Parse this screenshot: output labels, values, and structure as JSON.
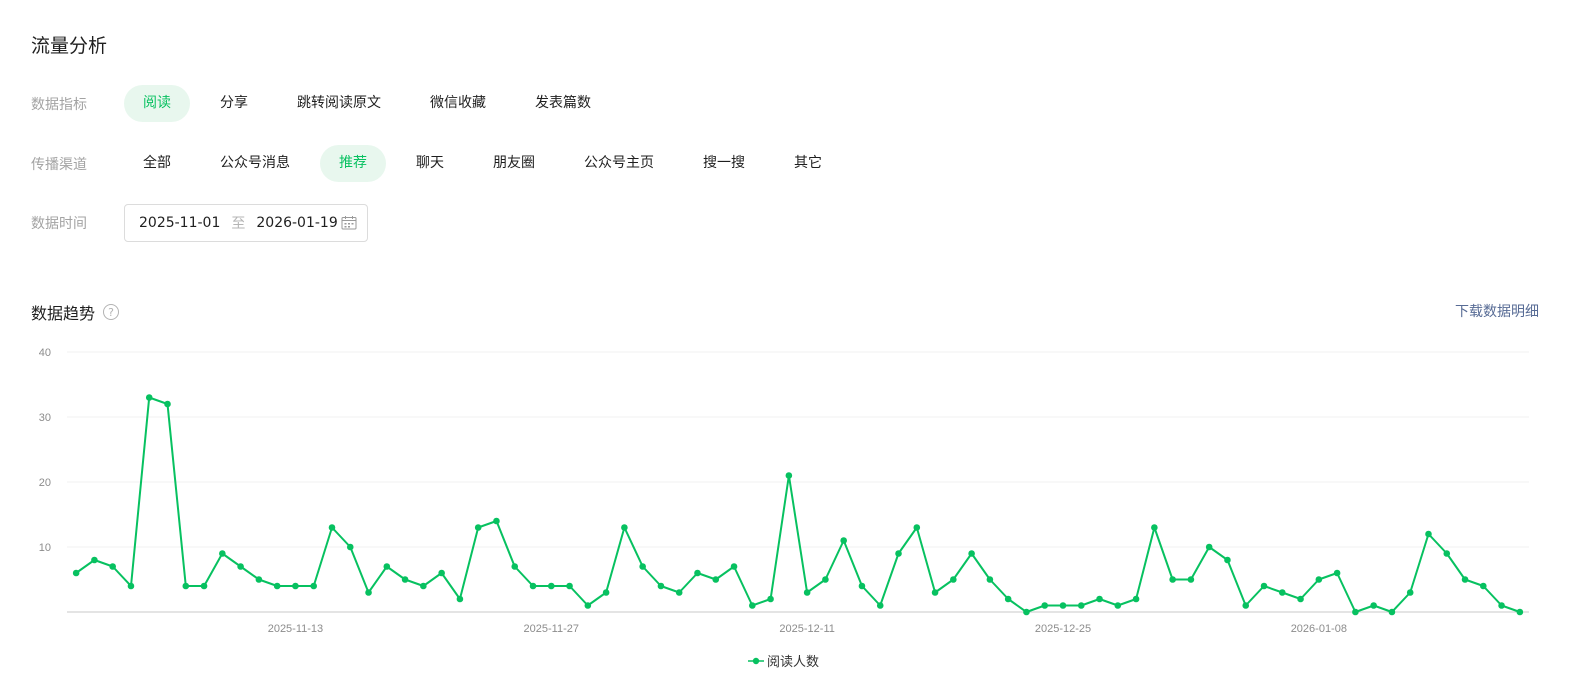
{
  "page_title": "流量分析",
  "filters": {
    "metric_label": "数据指标",
    "metrics": [
      "阅读",
      "分享",
      "跳转阅读原文",
      "微信收藏",
      "发表篇数"
    ],
    "metric_active": 0,
    "channel_label": "传播渠道",
    "channels": [
      "全部",
      "公众号消息",
      "推荐",
      "聊天",
      "朋友圈",
      "公众号主页",
      "搜一搜",
      "其它"
    ],
    "channel_active": 2,
    "date_label": "数据时间",
    "date_start": "2025-11-01",
    "date_sep": "至",
    "date_end": "2026-01-19"
  },
  "trend": {
    "title": "数据趋势",
    "help": "?",
    "download": "下载数据明细"
  },
  "colors": {
    "accent": "#07c160",
    "link": "#576b95"
  },
  "chart_data": {
    "type": "line",
    "title": "",
    "xlabel": "",
    "ylabel": "",
    "ylim": [
      0,
      40
    ],
    "yticks": [
      10,
      20,
      30,
      40
    ],
    "xtick_labels": [
      "2025-11-13",
      "2025-11-27",
      "2025-12-11",
      "2025-12-25",
      "2026-01-08"
    ],
    "x_start": "2025-11-01",
    "x_end": "2026-01-19",
    "grid": true,
    "legend_position": "bottom",
    "series": [
      {
        "name": "阅读人数",
        "color": "#07c160",
        "values": [
          6,
          8,
          7,
          4,
          33,
          32,
          4,
          4,
          9,
          7,
          5,
          4,
          4,
          4,
          13,
          10,
          3,
          7,
          5,
          4,
          6,
          2,
          13,
          14,
          7,
          4,
          4,
          4,
          1,
          3,
          13,
          7,
          4,
          3,
          6,
          5,
          7,
          1,
          2,
          21,
          3,
          5,
          11,
          4,
          1,
          9,
          13,
          3,
          5,
          9,
          5,
          2,
          0,
          1,
          1,
          1,
          2,
          1,
          2,
          13,
          5,
          5,
          10,
          8,
          1,
          4,
          3,
          2,
          5,
          6,
          0,
          1,
          0,
          3,
          12,
          9,
          5,
          4,
          1,
          0
        ]
      }
    ]
  }
}
